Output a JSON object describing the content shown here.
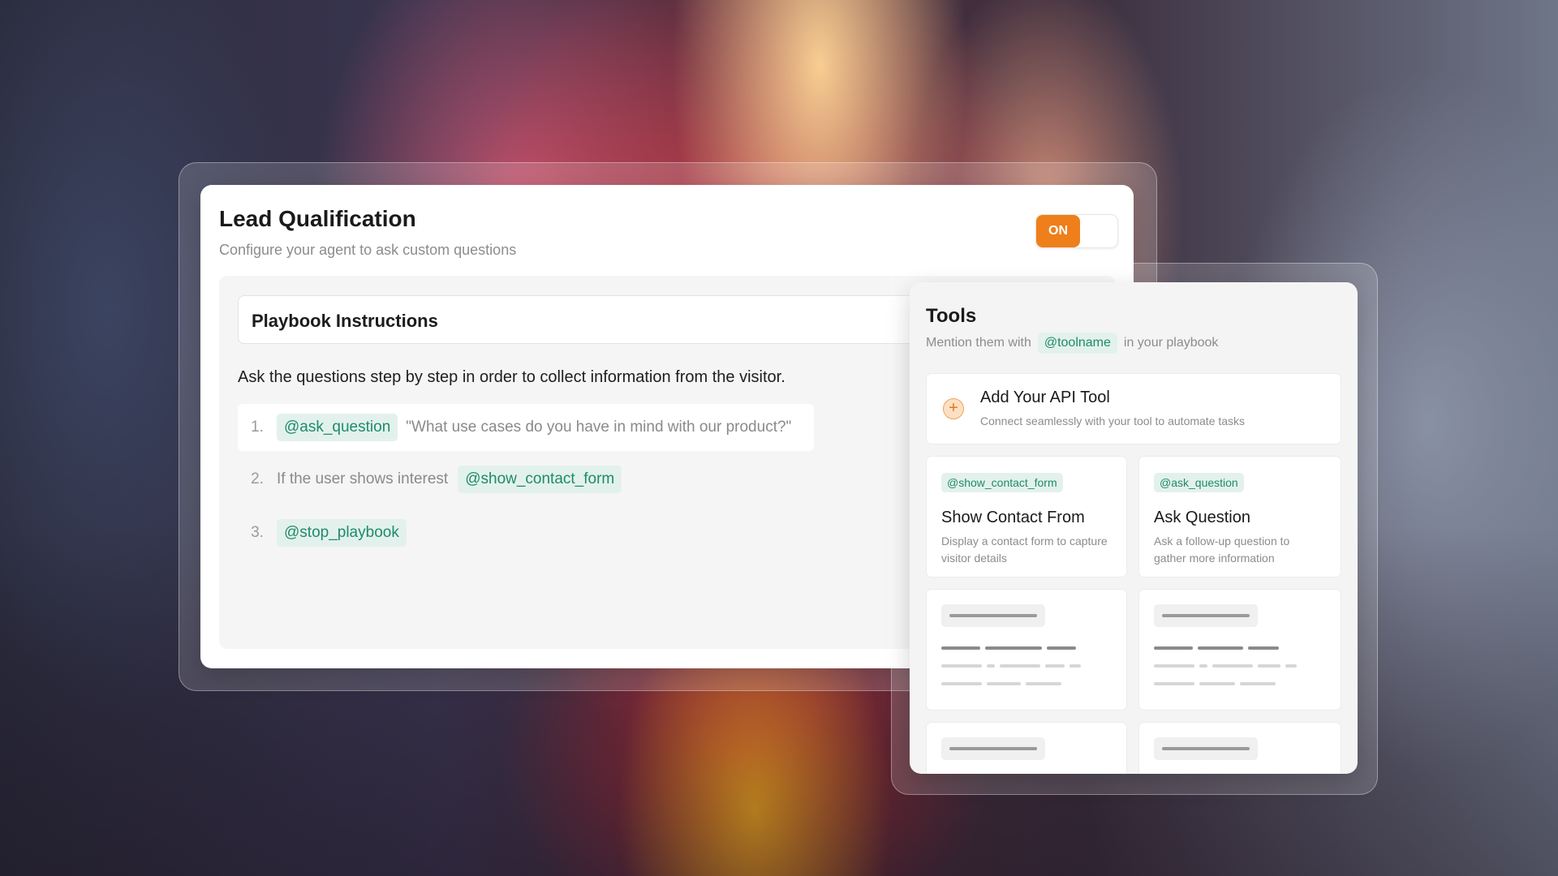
{
  "lead": {
    "title": "Lead Qualification",
    "subtitle": "Configure your agent to ask custom questions",
    "toggle_label": "ON",
    "toggle_state": "on",
    "accent_color": "#ef7f1a"
  },
  "playbook": {
    "header": "Playbook Instructions",
    "instruction": "Ask the questions step by step in order to collect information from the visitor.",
    "steps": [
      {
        "num": "1.",
        "tag": "@ask_question",
        "text": "\"What use cases do you have in mind with our product?\""
      },
      {
        "num": "2.",
        "text": "If the user shows interest",
        "tag": "@show_contact_form"
      },
      {
        "num": "3.",
        "tag": "@stop_playbook"
      }
    ],
    "tag_color": "#1e8b6b"
  },
  "tools": {
    "title": "Tools",
    "sub_before": "Mention them with",
    "sub_tag": "@toolname",
    "sub_after": "in your playbook",
    "api": {
      "icon": "plus-circle-icon",
      "title": "Add Your API Tool",
      "desc": "Connect seamlessly with your tool to automate tasks"
    },
    "items": [
      {
        "tag": "@show_contact_form",
        "title": "Show Contact From",
        "desc": "Display a contact form to capture visitor details"
      },
      {
        "tag": "@ask_question",
        "title": "Ask Question",
        "desc": "Ask a follow-up question to gather more information"
      }
    ]
  }
}
